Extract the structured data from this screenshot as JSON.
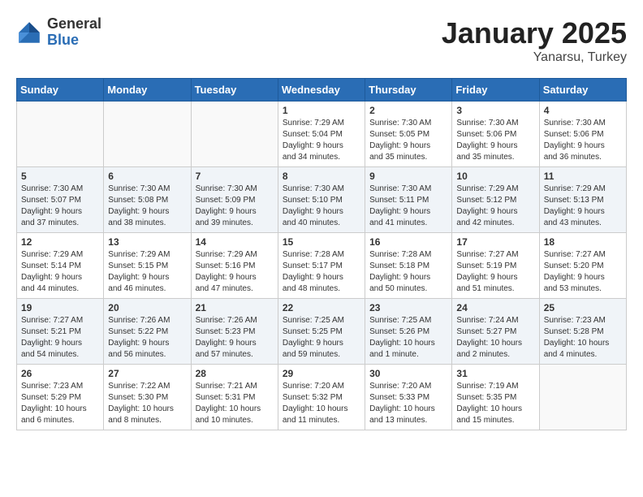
{
  "logo": {
    "general": "General",
    "blue": "Blue"
  },
  "title": "January 2025",
  "subtitle": "Yanarsu, Turkey",
  "headers": [
    "Sunday",
    "Monday",
    "Tuesday",
    "Wednesday",
    "Thursday",
    "Friday",
    "Saturday"
  ],
  "weeks": [
    [
      {
        "date": "",
        "info": ""
      },
      {
        "date": "",
        "info": ""
      },
      {
        "date": "",
        "info": ""
      },
      {
        "date": "1",
        "info": "Sunrise: 7:29 AM\nSunset: 5:04 PM\nDaylight: 9 hours\nand 34 minutes."
      },
      {
        "date": "2",
        "info": "Sunrise: 7:30 AM\nSunset: 5:05 PM\nDaylight: 9 hours\nand 35 minutes."
      },
      {
        "date": "3",
        "info": "Sunrise: 7:30 AM\nSunset: 5:06 PM\nDaylight: 9 hours\nand 35 minutes."
      },
      {
        "date": "4",
        "info": "Sunrise: 7:30 AM\nSunset: 5:06 PM\nDaylight: 9 hours\nand 36 minutes."
      }
    ],
    [
      {
        "date": "5",
        "info": "Sunrise: 7:30 AM\nSunset: 5:07 PM\nDaylight: 9 hours\nand 37 minutes."
      },
      {
        "date": "6",
        "info": "Sunrise: 7:30 AM\nSunset: 5:08 PM\nDaylight: 9 hours\nand 38 minutes."
      },
      {
        "date": "7",
        "info": "Sunrise: 7:30 AM\nSunset: 5:09 PM\nDaylight: 9 hours\nand 39 minutes."
      },
      {
        "date": "8",
        "info": "Sunrise: 7:30 AM\nSunset: 5:10 PM\nDaylight: 9 hours\nand 40 minutes."
      },
      {
        "date": "9",
        "info": "Sunrise: 7:30 AM\nSunset: 5:11 PM\nDaylight: 9 hours\nand 41 minutes."
      },
      {
        "date": "10",
        "info": "Sunrise: 7:29 AM\nSunset: 5:12 PM\nDaylight: 9 hours\nand 42 minutes."
      },
      {
        "date": "11",
        "info": "Sunrise: 7:29 AM\nSunset: 5:13 PM\nDaylight: 9 hours\nand 43 minutes."
      }
    ],
    [
      {
        "date": "12",
        "info": "Sunrise: 7:29 AM\nSunset: 5:14 PM\nDaylight: 9 hours\nand 44 minutes."
      },
      {
        "date": "13",
        "info": "Sunrise: 7:29 AM\nSunset: 5:15 PM\nDaylight: 9 hours\nand 46 minutes."
      },
      {
        "date": "14",
        "info": "Sunrise: 7:29 AM\nSunset: 5:16 PM\nDaylight: 9 hours\nand 47 minutes."
      },
      {
        "date": "15",
        "info": "Sunrise: 7:28 AM\nSunset: 5:17 PM\nDaylight: 9 hours\nand 48 minutes."
      },
      {
        "date": "16",
        "info": "Sunrise: 7:28 AM\nSunset: 5:18 PM\nDaylight: 9 hours\nand 50 minutes."
      },
      {
        "date": "17",
        "info": "Sunrise: 7:27 AM\nSunset: 5:19 PM\nDaylight: 9 hours\nand 51 minutes."
      },
      {
        "date": "18",
        "info": "Sunrise: 7:27 AM\nSunset: 5:20 PM\nDaylight: 9 hours\nand 53 minutes."
      }
    ],
    [
      {
        "date": "19",
        "info": "Sunrise: 7:27 AM\nSunset: 5:21 PM\nDaylight: 9 hours\nand 54 minutes."
      },
      {
        "date": "20",
        "info": "Sunrise: 7:26 AM\nSunset: 5:22 PM\nDaylight: 9 hours\nand 56 minutes."
      },
      {
        "date": "21",
        "info": "Sunrise: 7:26 AM\nSunset: 5:23 PM\nDaylight: 9 hours\nand 57 minutes."
      },
      {
        "date": "22",
        "info": "Sunrise: 7:25 AM\nSunset: 5:25 PM\nDaylight: 9 hours\nand 59 minutes."
      },
      {
        "date": "23",
        "info": "Sunrise: 7:25 AM\nSunset: 5:26 PM\nDaylight: 10 hours\nand 1 minute."
      },
      {
        "date": "24",
        "info": "Sunrise: 7:24 AM\nSunset: 5:27 PM\nDaylight: 10 hours\nand 2 minutes."
      },
      {
        "date": "25",
        "info": "Sunrise: 7:23 AM\nSunset: 5:28 PM\nDaylight: 10 hours\nand 4 minutes."
      }
    ],
    [
      {
        "date": "26",
        "info": "Sunrise: 7:23 AM\nSunset: 5:29 PM\nDaylight: 10 hours\nand 6 minutes."
      },
      {
        "date": "27",
        "info": "Sunrise: 7:22 AM\nSunset: 5:30 PM\nDaylight: 10 hours\nand 8 minutes."
      },
      {
        "date": "28",
        "info": "Sunrise: 7:21 AM\nSunset: 5:31 PM\nDaylight: 10 hours\nand 10 minutes."
      },
      {
        "date": "29",
        "info": "Sunrise: 7:20 AM\nSunset: 5:32 PM\nDaylight: 10 hours\nand 11 minutes."
      },
      {
        "date": "30",
        "info": "Sunrise: 7:20 AM\nSunset: 5:33 PM\nDaylight: 10 hours\nand 13 minutes."
      },
      {
        "date": "31",
        "info": "Sunrise: 7:19 AM\nSunset: 5:35 PM\nDaylight: 10 hours\nand 15 minutes."
      },
      {
        "date": "",
        "info": ""
      }
    ]
  ]
}
